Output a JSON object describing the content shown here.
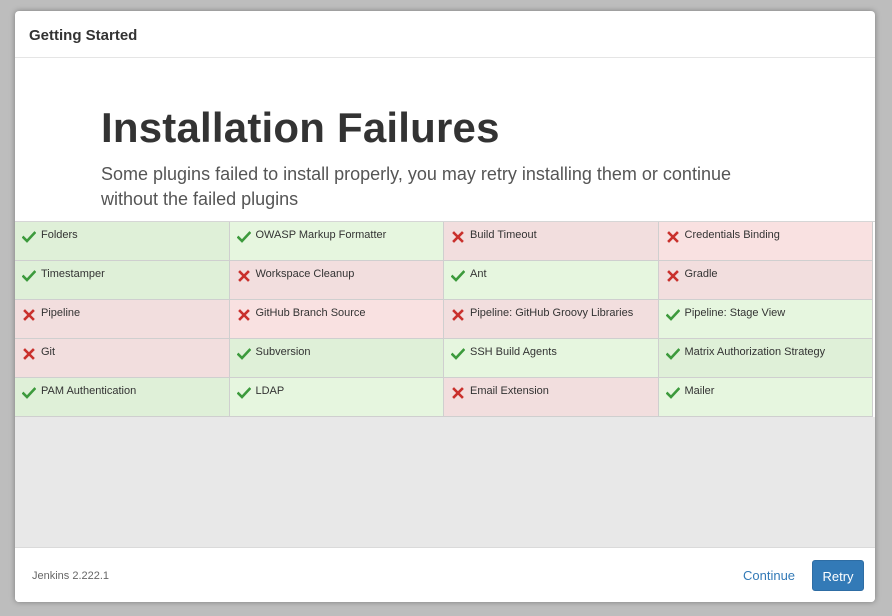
{
  "dialog": {
    "title": "Getting Started"
  },
  "intro": {
    "heading": "Installation Failures",
    "description": "Some plugins failed to install properly, you may retry installing them or continue without the failed plugins"
  },
  "plugins": [
    {
      "name": "Folders",
      "status": "success"
    },
    {
      "name": "OWASP Markup Formatter",
      "status": "success"
    },
    {
      "name": "Build Timeout",
      "status": "failed"
    },
    {
      "name": "Credentials Binding",
      "status": "failed"
    },
    {
      "name": "Timestamper",
      "status": "success"
    },
    {
      "name": "Workspace Cleanup",
      "status": "failed"
    },
    {
      "name": "Ant",
      "status": "success"
    },
    {
      "name": "Gradle",
      "status": "failed"
    },
    {
      "name": "Pipeline",
      "status": "failed"
    },
    {
      "name": "GitHub Branch Source",
      "status": "failed"
    },
    {
      "name": "Pipeline: GitHub Groovy Libraries",
      "status": "failed"
    },
    {
      "name": "Pipeline: Stage View",
      "status": "success"
    },
    {
      "name": "Git",
      "status": "failed"
    },
    {
      "name": "Subversion",
      "status": "success"
    },
    {
      "name": "SSH Build Agents",
      "status": "success"
    },
    {
      "name": "Matrix Authorization Strategy",
      "status": "success"
    },
    {
      "name": "PAM Authentication",
      "status": "success"
    },
    {
      "name": "LDAP",
      "status": "success"
    },
    {
      "name": "Email Extension",
      "status": "failed"
    },
    {
      "name": "Mailer",
      "status": "success"
    }
  ],
  "footer": {
    "version": "Jenkins 2.222.1",
    "continue_label": "Continue",
    "retry_label": "Retry"
  },
  "colors": {
    "success_mark": "#3c9a3c",
    "failed_mark": "#c9302c",
    "primary": "#337ab7"
  }
}
